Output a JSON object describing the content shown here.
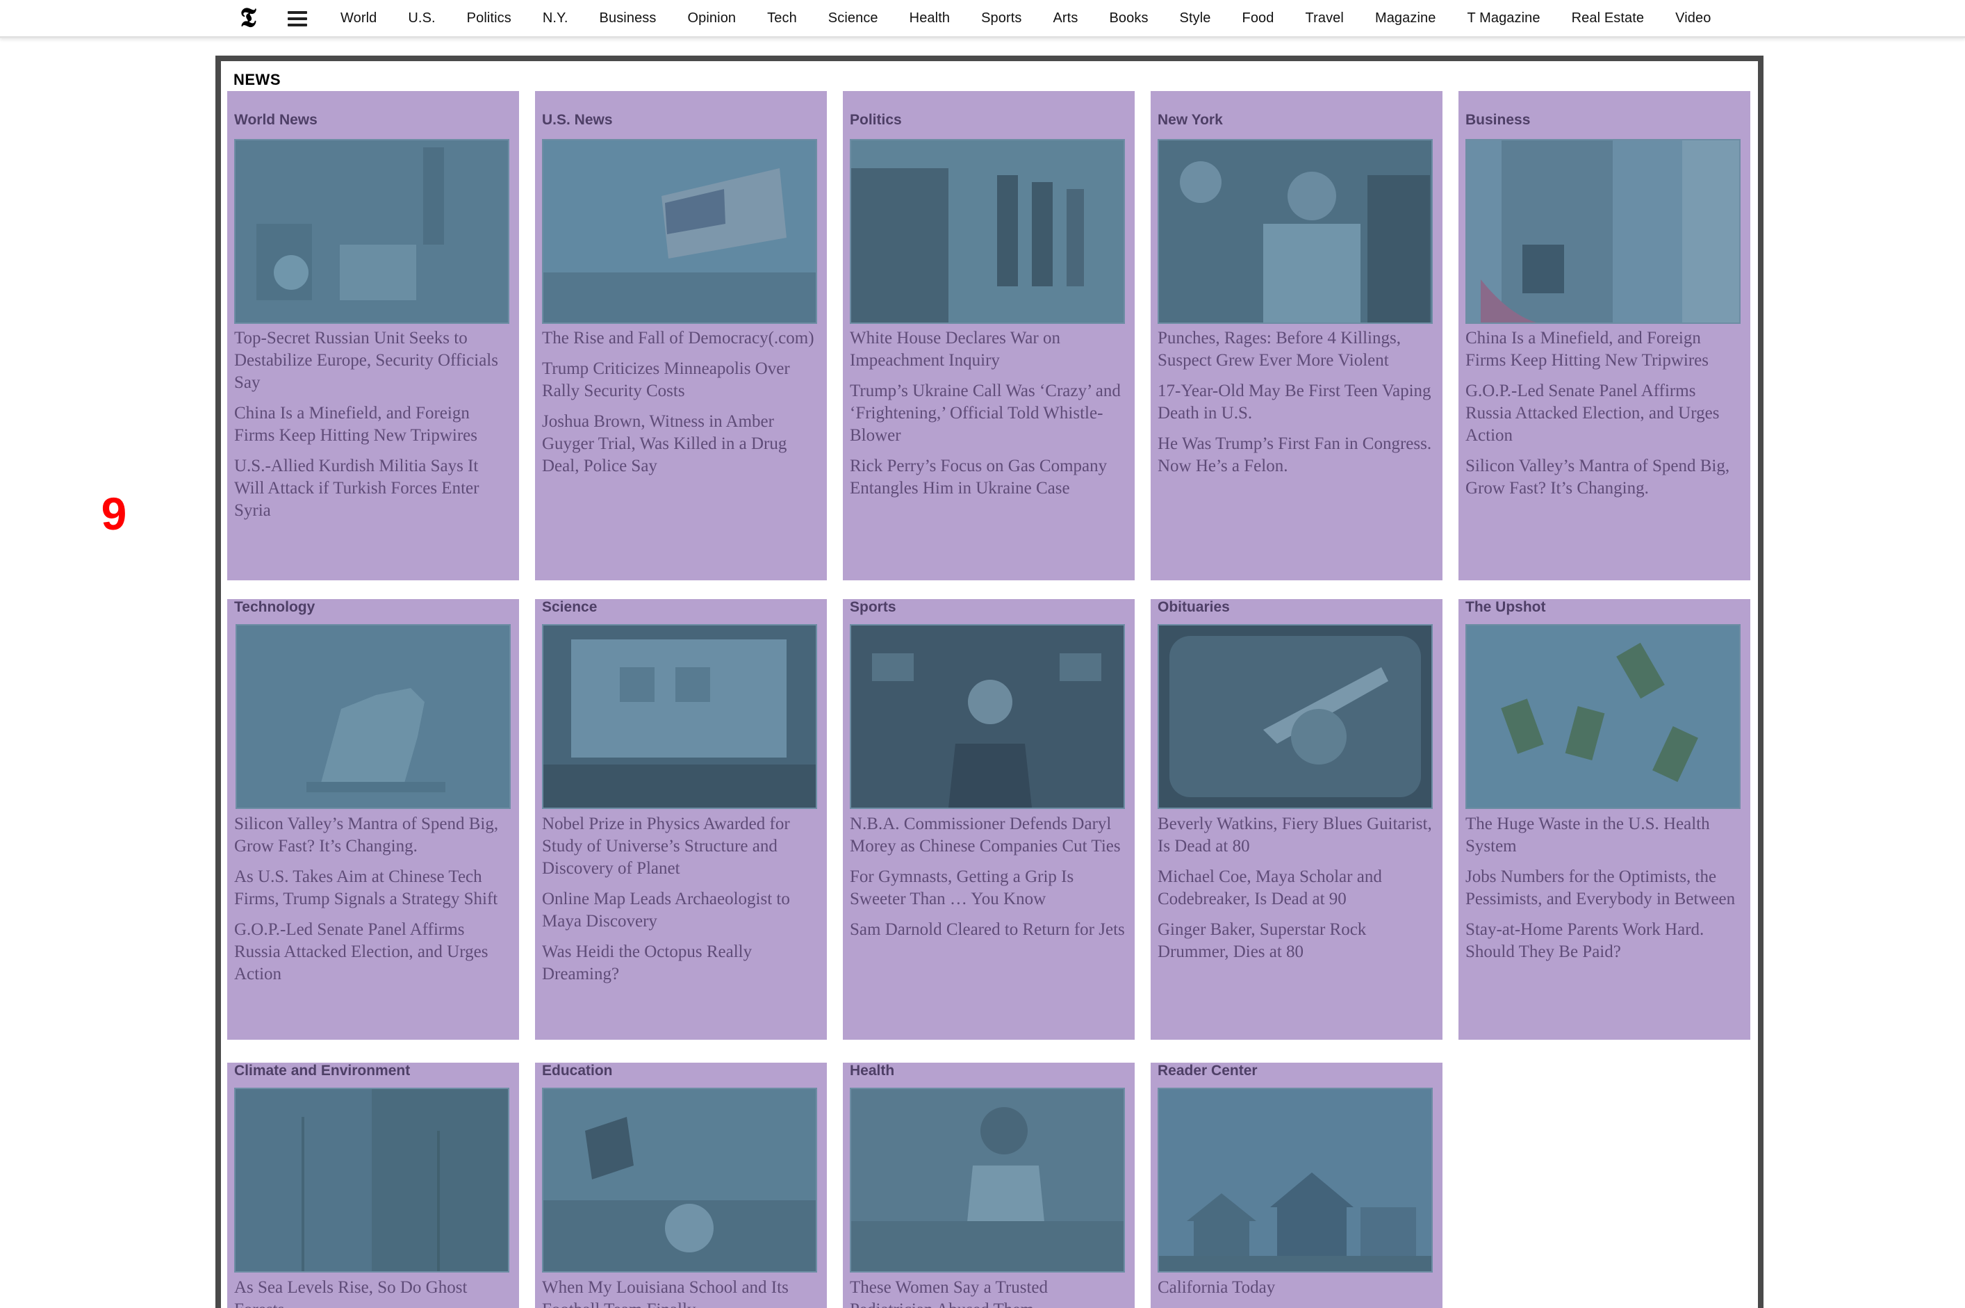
{
  "nav": {
    "logo": "𝕿",
    "items": [
      "World",
      "U.S.",
      "Politics",
      "N.Y.",
      "Business",
      "Opinion",
      "Tech",
      "Science",
      "Health",
      "Sports",
      "Arts",
      "Books",
      "Style",
      "Food",
      "Travel",
      "Magazine",
      "T Magazine",
      "Real Estate",
      "Video"
    ]
  },
  "marker": "9",
  "news": {
    "heading": "NEWS",
    "sections": [
      {
        "label": "World News",
        "headlines": [
          "Top-Secret Russian Unit Seeks to Destabilize Europe, Security Officials Say",
          "China Is a Minefield, and Foreign Firms Keep Hitting New Tripwires",
          "U.S.-Allied Kurdish Militia Says It Will Attack if Turkish Forces Enter Syria"
        ]
      },
      {
        "label": "U.S. News",
        "headlines": [
          "The Rise and Fall of Democracy(.com)",
          "Trump Criticizes Minneapolis Over Rally Security Costs",
          "Joshua Brown, Witness in Amber Guyger Trial, Was Killed in a Drug Deal, Police Say"
        ]
      },
      {
        "label": "Politics",
        "headlines": [
          "White House Declares War on Impeachment Inquiry",
          "Trump’s Ukraine Call Was ‘Crazy’ and ‘Frightening,’ Official Told Whistle-Blower",
          "Rick Perry’s Focus on Gas Company Entangles Him in Ukraine Case"
        ]
      },
      {
        "label": "New York",
        "headlines": [
          "Punches, Rages: Before 4 Killings, Suspect Grew Ever More Violent",
          "17-Year-Old May Be First Teen Vaping Death in U.S.",
          "He Was Trump’s First Fan in Congress. Now He’s a Felon."
        ]
      },
      {
        "label": "Business",
        "headlines": [
          "China Is a Minefield, and Foreign Firms Keep Hitting New Tripwires",
          "G.O.P.-Led Senate Panel Affirms Russia Attacked Election, and Urges Action",
          "Silicon Valley’s Mantra of Spend Big, Grow Fast? It’s Changing."
        ]
      },
      {
        "label": "Technology",
        "headlines": [
          "Silicon Valley’s Mantra of Spend Big, Grow Fast? It’s Changing.",
          "As U.S. Takes Aim at Chinese Tech Firms, Trump Signals a Strategy Shift",
          "G.O.P.-Led Senate Panel Affirms Russia Attacked Election, and Urges Action"
        ]
      },
      {
        "label": "Science",
        "headlines": [
          "Nobel Prize in Physics Awarded for Study of Universe’s Structure and Discovery of Planet",
          "Online Map Leads Archaeologist to Maya Discovery",
          "Was Heidi the Octopus Really Dreaming?"
        ]
      },
      {
        "label": "Sports",
        "headlines": [
          "N.B.A. Commissioner Defends Daryl Morey as Chinese Companies Cut Ties",
          "For Gymnasts, Getting a Grip Is Sweeter Than … You Know",
          "Sam Darnold Cleared to Return for Jets"
        ]
      },
      {
        "label": "Obituaries",
        "headlines": [
          "Beverly Watkins, Fiery Blues Guitarist, Is Dead at 80",
          "Michael Coe, Maya Scholar and Codebreaker, Is Dead at 90",
          "Ginger Baker, Superstar Rock Drummer, Dies at 80"
        ]
      },
      {
        "label": "The Upshot",
        "headlines": [
          "The Huge Waste in the U.S. Health System",
          "Jobs Numbers for the Optimists, the Pessimists, and Everybody in Between",
          "Stay-at-Home Parents Work Hard. Should They Be Paid?"
        ]
      },
      {
        "label": "Climate and Environment",
        "headlines": [
          "As Sea Levels Rise, So Do Ghost Forests"
        ]
      },
      {
        "label": "Education",
        "headlines": [
          "When My Louisiana School and Its Football Team Finally"
        ]
      },
      {
        "label": "Health",
        "headlines": [
          "These Women Say a Trusted Pediatrician Abused Them"
        ]
      },
      {
        "label": "Reader Center",
        "headlines": [
          "California Today"
        ]
      }
    ]
  }
}
